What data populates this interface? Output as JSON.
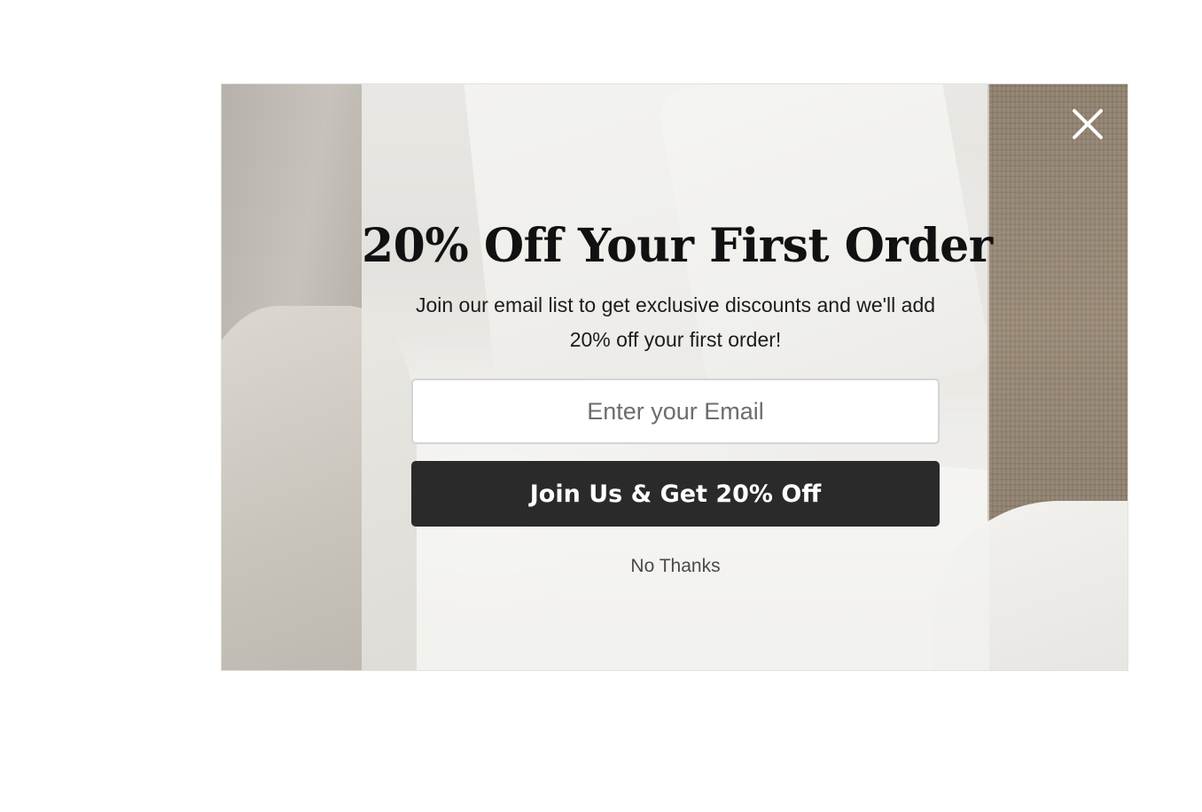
{
  "popup": {
    "title": "20% Off Your First Order",
    "subtitle": "Join our email list to get exclusive discounts and we'll add 20% off your first order!",
    "email": {
      "placeholder": "Enter your Email",
      "value": ""
    },
    "submit_label": "Join Us & Get 20% Off",
    "dismiss_label": "No Thanks",
    "close_icon": "close-icon"
  },
  "colors": {
    "button_bg": "#2a2a2a",
    "button_text": "#ffffff",
    "title_text": "#111111",
    "panel_overlay": "#f4f3f0"
  }
}
